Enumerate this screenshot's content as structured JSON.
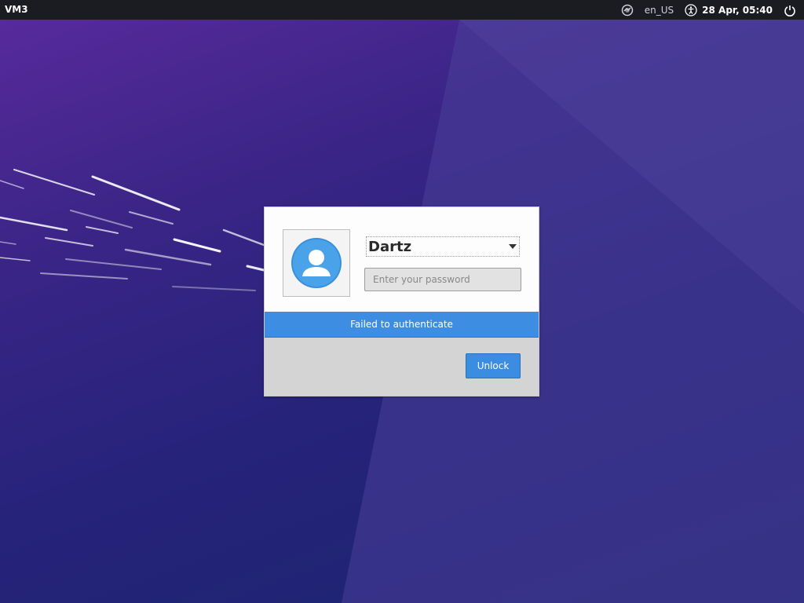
{
  "topbar": {
    "hostname": "VM3",
    "network_icon": "network-icon",
    "keyboard_layout": "en_US",
    "accessibility_icon": "accessibility-icon",
    "datetime": "28 Apr, 05:40",
    "power_icon": "power-icon"
  },
  "dialog": {
    "avatar_icon": "user-avatar-icon",
    "username": "Dartz",
    "password_placeholder": "Enter your password",
    "password_value": "",
    "message": "Failed to authenticate",
    "unlock_label": "Unlock"
  },
  "colors": {
    "accent": "#3d8ee3",
    "topbar_bg": "#1b1b22",
    "background_primary": "#3a2586"
  }
}
